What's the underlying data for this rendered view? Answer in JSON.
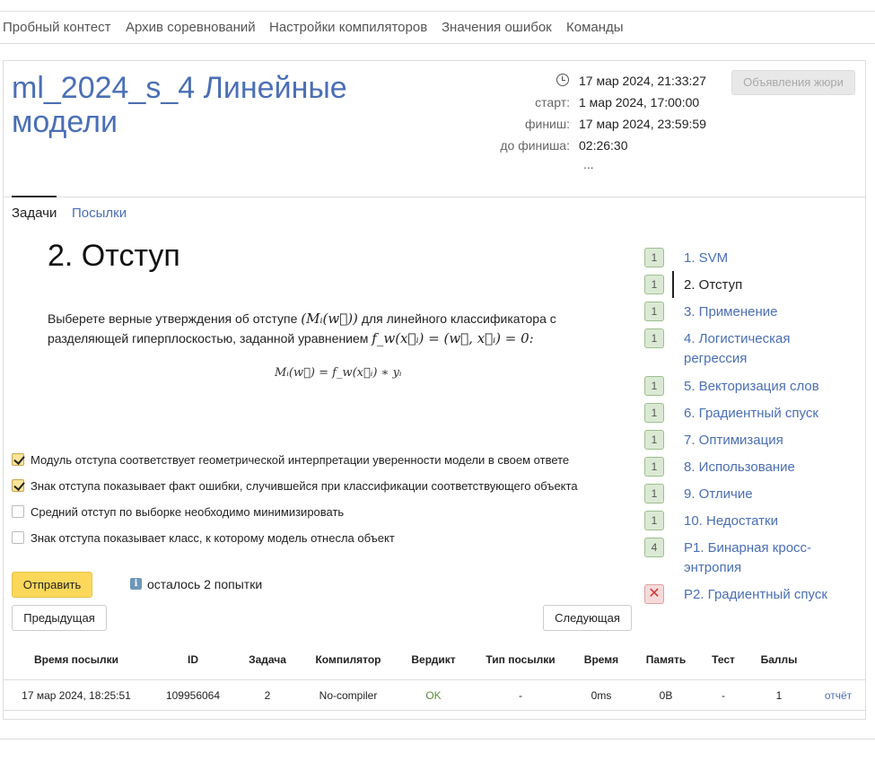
{
  "topnav": [
    "Пробный контест",
    "Архив соревнований",
    "Настройки компиляторов",
    "Значения ошибок",
    "Команды"
  ],
  "contest": {
    "title": "ml_2024_s_4 Линейные модели",
    "now": "17 мар 2024, 21:33:27",
    "start_label": "старт:",
    "start": "1 мар 2024, 17:00:00",
    "finish_label": "финиш:",
    "finish": "17 мар 2024, 23:59:59",
    "left_label": "до финиша:",
    "left": "02:26:30",
    "more": "...",
    "jury_button": "Объявления жюри"
  },
  "tabs": {
    "tasks": "Задачи",
    "submissions": "Посылки"
  },
  "task": {
    "title": "2. Отступ",
    "statement_1": "Выберете верные утверждения об отступе",
    "statement_math_1": "(Mᵢ(w⃗))",
    "statement_2": "для линейного классификатора с разделяющей гиперплоскостью, заданной уравнением",
    "statement_math_2": "f_w(x⃗ᵢ) = (w⃗, x⃗ᵢ) = 0:",
    "formula": "Mᵢ(w⃗) = f_w(x⃗ᵢ) ∗ yᵢ"
  },
  "options": [
    {
      "label": "Модуль отступа соответствует геометрической интерпретации уверенности модели в своем ответе",
      "checked": true
    },
    {
      "label": "Знак отступа показывает факт ошибки, случившейся при классификации соответствующего объекта",
      "checked": true
    },
    {
      "label": "Средний отступ по выборке необходимо минимизировать",
      "checked": false
    },
    {
      "label": "Знак отступа показывает класс, к которому модель отнесла объект",
      "checked": false
    }
  ],
  "submit_label": "Отправить",
  "attempts_text": "осталось 2 попытки",
  "info_icon": "i",
  "prev_label": "Предыдущая",
  "next_label": "Следующая",
  "sidebar": [
    {
      "badge": "1",
      "label": "1. SVM",
      "status": "ok"
    },
    {
      "badge": "1",
      "label": "2. Отступ",
      "status": "ok",
      "current": true
    },
    {
      "badge": "1",
      "label": "3. Применение",
      "status": "ok"
    },
    {
      "badge": "1",
      "label": "4. Логистическая регрессия",
      "status": "ok"
    },
    {
      "badge": "1",
      "label": "5. Векторизация слов",
      "status": "ok"
    },
    {
      "badge": "1",
      "label": "6. Градиентный спуск",
      "status": "ok"
    },
    {
      "badge": "1",
      "label": "7. Оптимизация",
      "status": "ok"
    },
    {
      "badge": "1",
      "label": "8. Использование",
      "status": "ok"
    },
    {
      "badge": "1",
      "label": "9. Отличие",
      "status": "ok"
    },
    {
      "badge": "1",
      "label": "10. Недостатки",
      "status": "ok"
    },
    {
      "badge": "4",
      "label": "P1. Бинарная кросс-энтропия",
      "status": "ok"
    },
    {
      "badge": "✕",
      "label": "P2. Градиентный спуск",
      "status": "fail"
    }
  ],
  "table": {
    "headers": [
      "Время посылки",
      "ID",
      "Задача",
      "Компилятор",
      "Вердикт",
      "Тип посылки",
      "Время",
      "Память",
      "Тест",
      "Баллы"
    ],
    "row": [
      "17 мар 2024, 18:25:51",
      "109956064",
      "2",
      "No-compiler",
      "OK",
      "-",
      "0ms",
      "0B",
      "-",
      "1"
    ],
    "report_link": "отчёт"
  },
  "colors": {
    "link": "#4a6fb5",
    "verdict_ok": "#5a8a3a",
    "submit": "#fbd859"
  }
}
